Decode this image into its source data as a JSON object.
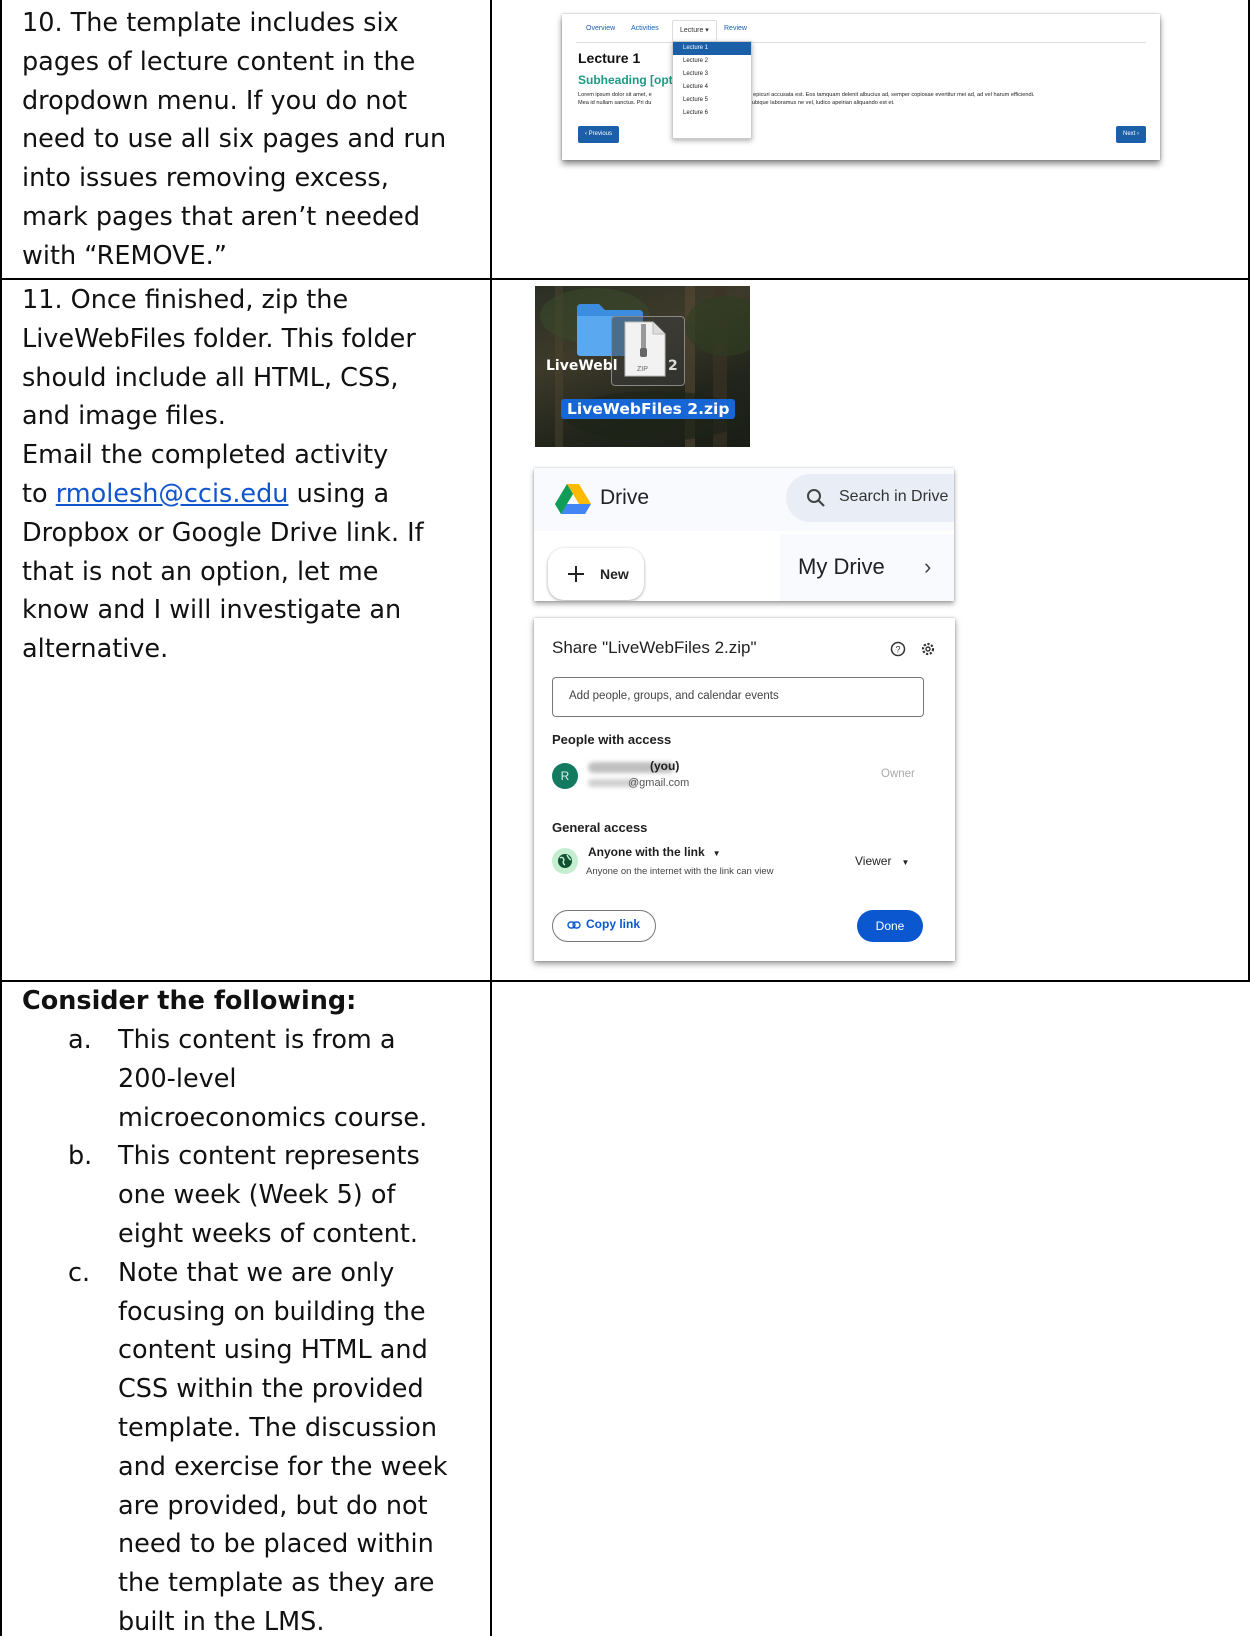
{
  "row10": {
    "lines": [
      "10.  The template includes six",
      "pages of lecture content in the",
      "dropdown menu. If you do not",
      "need to use all six pages and run",
      "into issues removing excess,",
      "mark pages that aren’t needed",
      "with “REMOVE.”"
    ]
  },
  "row11": {
    "lines": [
      "11.  Once finished, zip the",
      "LiveWebFiles folder. This folder",
      "should include all HTML, CSS,",
      "and image files.",
      "Email the completed activity"
    ],
    "email_prefix": "to ",
    "email": "rmolesh@ccis.edu",
    "email_suffix": " using a",
    "lines_after": [
      "Dropbox or Google Drive link. If",
      "that is not an option, let me",
      "know and I will investigate an",
      "alternative."
    ]
  },
  "consider": {
    "heading": "Consider the following:",
    "items": [
      {
        "marker": "a.",
        "lines": [
          "This content is from a",
          "200-level",
          "microeconomics course."
        ]
      },
      {
        "marker": "b.",
        "lines": [
          "This content represents",
          "one week (Week 5) of",
          "eight weeks of content."
        ]
      },
      {
        "marker": "c.",
        "lines": [
          "Note that we are only",
          "focusing on building the",
          "content using HTML and",
          "CSS within the provided",
          "template. The discussion",
          "and exercise for the week",
          "are provided, but do not",
          "need to be placed within",
          "the template as they are",
          "built in the LMS."
        ]
      }
    ]
  },
  "lecture_shot": {
    "tabs": [
      "Overview",
      "Activities",
      "Lecture ▾",
      "Review"
    ],
    "dropdown": [
      "Lecture 1",
      "Lecture 2",
      "Lecture 3",
      "Lecture 4",
      "Lecture 5",
      "Lecture 6"
    ],
    "title": "Lecture 1",
    "subheading": "Subheading [opt",
    "body_left_1": "Lorem ipsum dolor sit amet, e",
    "body_right_1": ", ex mollis epicuri accusata est. Eos tamquam delenit albucius ad, semper copiosae evertitur mei ad, ad vel harum efficiendi.",
    "body_left_2": "Mea id nullam sanctus. Pri du",
    "body_right_2": "t et, simul ubique laboramus ne vel, ludico apeirian aliquando est et.",
    "prev": "‹ Previous",
    "next": "Next ›",
    "accent": "#1b5fa8"
  },
  "zip_shot": {
    "folder_label": "LiveWebl",
    "folder_tail": "2",
    "zip_tag": "ZIP",
    "file_name": "LiveWebFiles 2.zip"
  },
  "drive_shot": {
    "brand": "Drive",
    "search": "Search in Drive",
    "new": "New",
    "my_drive": "My Drive",
    "chevron": "›"
  },
  "share_shot": {
    "title": "Share \"LiveWebFiles 2.zip\"",
    "input_placeholder": "Add people, groups, and calendar events",
    "people_heading": "People with access",
    "avatar_letter": "R",
    "person_you": "(you)",
    "person_email": "@gmail.com",
    "owner": "Owner",
    "general_heading": "General access",
    "access_title": "Anyone with the link",
    "access_desc": "Anyone on the internet with the link can view",
    "role": "Viewer",
    "copy_link": "Copy link",
    "done": "Done",
    "accent": "#0b57d0"
  }
}
